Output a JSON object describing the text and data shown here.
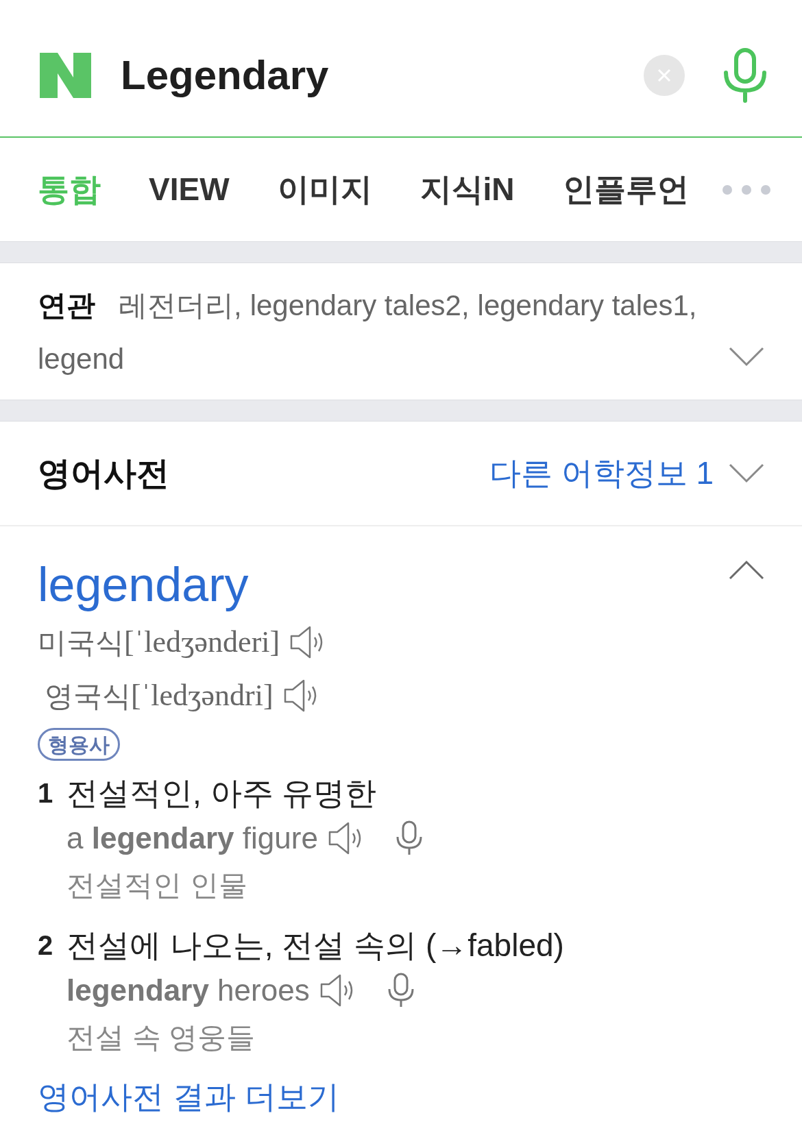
{
  "search": {
    "query": "Legendary"
  },
  "tabs": [
    {
      "label": "통합",
      "selected": true
    },
    {
      "label": "VIEW",
      "selected": false
    },
    {
      "label": "이미지",
      "selected": false
    },
    {
      "label": "지식iN",
      "selected": false
    },
    {
      "label": "인플루언",
      "selected": false
    }
  ],
  "related": {
    "label": "연관",
    "terms": [
      "레전더리,",
      "legendary tales2,",
      "legendary tales1,",
      "legend"
    ],
    "expanded": false
  },
  "dictionary": {
    "title": "영어사전",
    "other_info": {
      "label": "다른 어학정보 1",
      "expanded": false
    },
    "entry": {
      "word": "legendary",
      "expanded": true,
      "pronunciations": [
        {
          "label": "미국식",
          "phonetic": "[ˈledʒənderi]"
        },
        {
          "label": "영국식",
          "phonetic": "[ˈledʒəndri]"
        }
      ],
      "part_of_speech": "형용사",
      "senses": [
        {
          "number": "1",
          "meaning": "전설적인, 아주 유명한",
          "example": "a **legendary** figure",
          "translation": "전설적인 인물"
        },
        {
          "number": "2",
          "meaning": "전설에 나오는, 전설 속의 (→fabled)",
          "example": "**legendary** heroes",
          "translation": "전설 속 영웅들"
        }
      ]
    },
    "more_link": "영어사전 결과 더보기"
  }
}
